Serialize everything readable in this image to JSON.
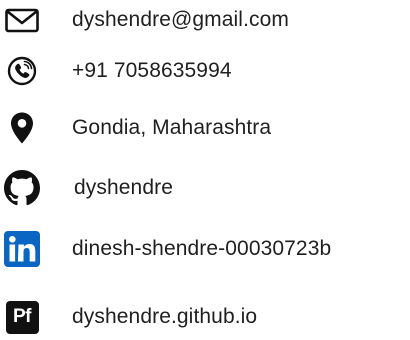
{
  "contacts": {
    "email": {
      "icon": "envelope-icon",
      "text": "dyshendre@gmail.com"
    },
    "phone": {
      "icon": "phone-icon",
      "text": "+91 7058635994"
    },
    "location": {
      "icon": "map-pin-icon",
      "text": "Gondia, Maharashtra"
    },
    "github": {
      "icon": "github-icon",
      "text": "dyshendre"
    },
    "linkedin": {
      "icon": "linkedin-icon",
      "text": "dinesh-shendre-00030723b",
      "color": "#0a66c2"
    },
    "portfolio": {
      "icon": "portfolio-icon",
      "badge": "Pf",
      "text": "dyshendre.github.io"
    }
  },
  "colors": {
    "text": "#1f1f1f",
    "icon": "#111111",
    "linkedin": "#0a66c2"
  }
}
